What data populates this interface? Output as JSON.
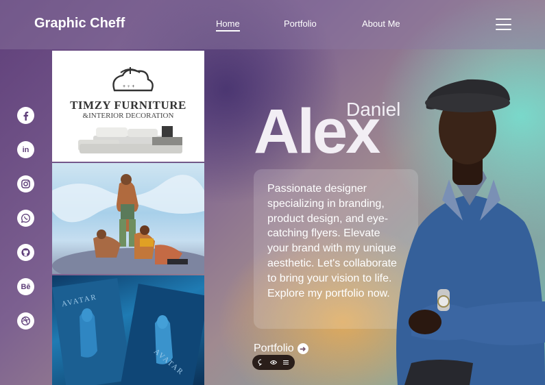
{
  "header": {
    "brand": "Graphic Cheff",
    "nav": [
      {
        "label": "Home",
        "active": true
      },
      {
        "label": "Portfolio",
        "active": false
      },
      {
        "label": "About Me",
        "active": false
      }
    ],
    "menu_icon": "hamburger-icon"
  },
  "social": [
    {
      "icon": "facebook-icon"
    },
    {
      "icon": "linkedin-icon",
      "glyph": "in"
    },
    {
      "icon": "instagram-icon"
    },
    {
      "icon": "whatsapp-icon"
    },
    {
      "icon": "github-icon"
    },
    {
      "icon": "behance-icon",
      "glyph": "Bē"
    },
    {
      "icon": "dribbble-icon"
    }
  ],
  "gallery": {
    "card1": {
      "title": "TIMZY FURNITURE",
      "subtitle": "&INTERIOR DECORATION"
    },
    "card2": {
      "image": "illustration-artwork"
    },
    "card3": {
      "image": "avatar-poster-artwork",
      "text": "AVATAR"
    }
  },
  "hero": {
    "first_name": "Daniel",
    "last_name": "Alex",
    "bio": "Passionate designer specializing in branding, product design, and eye-catching flyers. Elevate your brand with my unique aesthetic. Let's collaborate to bring your vision to life. Explore my portfolio now.",
    "cta_label": "Portfolio",
    "cta_icon": "arrow-right-icon",
    "pill_icons": [
      "chat-icon",
      "eye-icon",
      "menu-icon"
    ]
  },
  "colors": {
    "brand_purple": "#5f3f7a",
    "teal": "#6fb9b0",
    "accent_orange": "#e2aa5a"
  }
}
